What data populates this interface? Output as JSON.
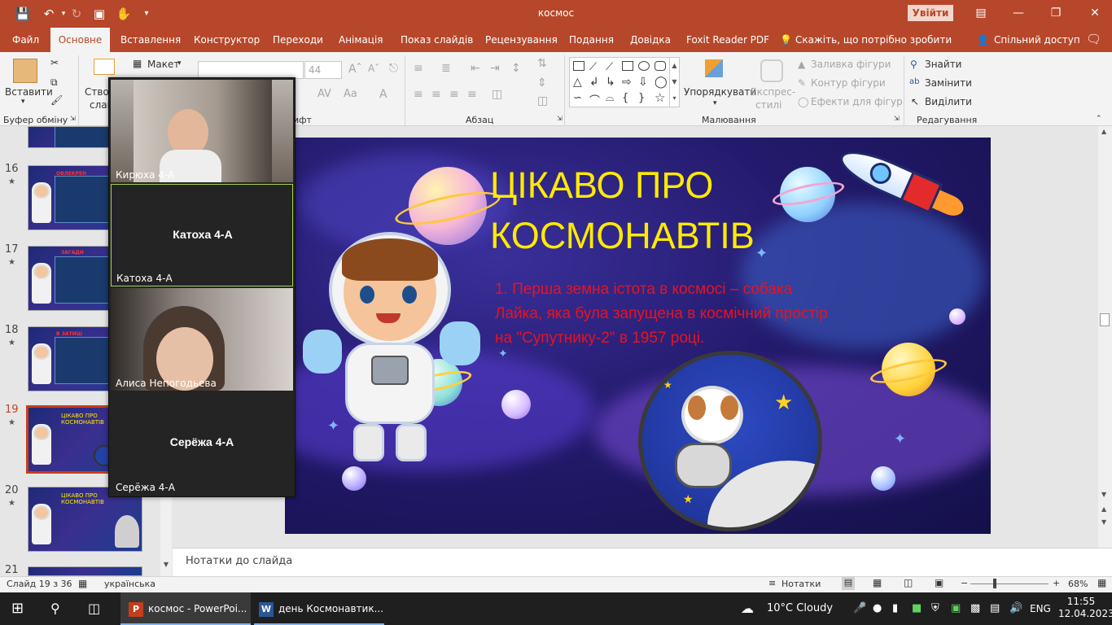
{
  "window": {
    "title": "космос",
    "signin": "Увійти"
  },
  "tabs": [
    "Файл",
    "Основне",
    "Вставлення",
    "Конструктор",
    "Переходи",
    "Анімація",
    "Показ слайдів",
    "Рецензування",
    "Подання",
    "Довідка",
    "Foxit Reader PDF"
  ],
  "tellme": "Скажіть, що потрібно зробити",
  "share": "Спільний доступ",
  "ribbon": {
    "paste": "Вставити",
    "create_slide_1": "Створ",
    "create_slide_2": "слай",
    "layout": "Макет",
    "font_name": "",
    "font_size": "44",
    "arrange": "Упорядкувати",
    "quick_styles_1": "Експрес-",
    "quick_styles_2": "стилі",
    "shape_fill": "Заливка фігури",
    "shape_outline": "Контур фігури",
    "shape_effects": "Ефекти для фігур",
    "find": "Знайти",
    "replace": "Замінити",
    "select": "Виділити",
    "groups": {
      "clipboard": "Буфер обміну",
      "font": "ифт",
      "paragraph": "Абзац",
      "drawing": "Малювання",
      "editing": "Редагування"
    }
  },
  "slides": [
    {
      "num": "16",
      "label": "ОВЛЕКРЕН"
    },
    {
      "num": "17",
      "label": "ЗАГАДИ"
    },
    {
      "num": "18",
      "label": "В ЗАТИШ"
    },
    {
      "num": "19",
      "label": "ЦІКАВО ПРО КОСМОНАВТІВ"
    },
    {
      "num": "20",
      "label": "ЦІКАВО ПРО КОСМОНАВТІВ"
    },
    {
      "num": "21",
      "label": ""
    }
  ],
  "slide": {
    "title": "ЦІКАВО ПРО КОСМОНАВТІВ",
    "body": "1. Перша земна істота в космосі – собака Лайка, яка була запущена в космічний простір на \"Супутнику-2\" в 1957 році."
  },
  "notes": "Нотатки до слайда",
  "status": {
    "slide_of": "Слайд 19 з 36",
    "language": "українська",
    "notes_btn": "Нотатки",
    "zoom": "68%"
  },
  "participants": [
    {
      "name": "Кирюха 4-А",
      "video": true
    },
    {
      "name": "Катоха 4-А",
      "video": false
    },
    {
      "name": "Алиса Непогодьева",
      "video": true
    },
    {
      "name": "Серёжа 4-А",
      "video": false
    }
  ],
  "taskbar": {
    "apps": [
      {
        "label": "космос - PowerPoi..."
      },
      {
        "label": "день Космонавтик..."
      }
    ],
    "weather": "10°C  Cloudy",
    "lang": "ENG",
    "time": "11:55",
    "date": "12.04.2023"
  },
  "colors": {
    "accent": "#b7472a",
    "slide_title": "#ffea00",
    "slide_body": "#e8131f"
  }
}
